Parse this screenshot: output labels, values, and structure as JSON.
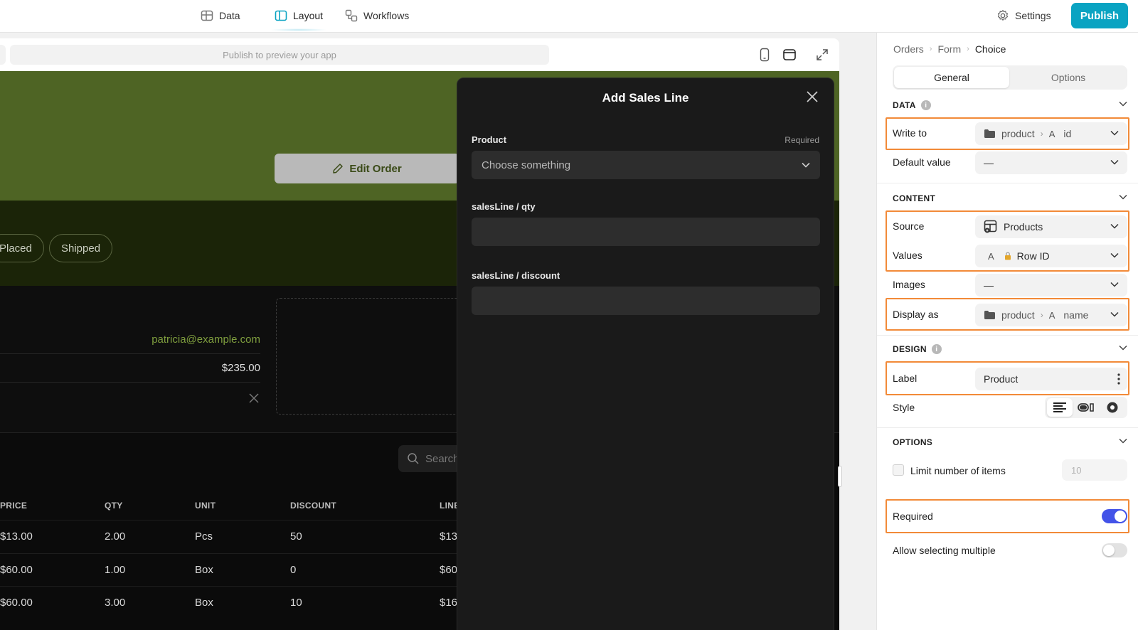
{
  "topbar": {
    "tabs": [
      {
        "label": "Data",
        "icon": "table-icon"
      },
      {
        "label": "Layout",
        "icon": "layout-icon"
      },
      {
        "label": "Workflows",
        "icon": "workflow-icon"
      }
    ],
    "settings_label": "Settings",
    "publish_label": "Publish"
  },
  "preview": {
    "url_placeholder": "Publish to preview your app"
  },
  "app": {
    "edit_order_label": "Edit Order",
    "status_pills": [
      "Placed",
      "Shipped"
    ],
    "info": {
      "email": "patricia@example.com",
      "amount": "$235.00"
    },
    "search_placeholder": "Search",
    "table": {
      "columns": [
        "PRICE",
        "QTY",
        "UNIT",
        "DISCOUNT",
        "LINE"
      ],
      "rows": [
        [
          "$13.00",
          "2.00",
          "Pcs",
          "50",
          "$13"
        ],
        [
          "$60.00",
          "1.00",
          "Box",
          "0",
          "$60"
        ],
        [
          "$60.00",
          "3.00",
          "Box",
          "10",
          "$16"
        ]
      ]
    }
  },
  "modal": {
    "title": "Add Sales Line",
    "fields": [
      {
        "label": "Product",
        "required_text": "Required",
        "placeholder": "Choose something"
      },
      {
        "label": "salesLine / qty",
        "value": ""
      },
      {
        "label": "salesLine / discount",
        "value": ""
      }
    ]
  },
  "panel": {
    "breadcrumb": [
      "Orders",
      "Form",
      "Choice"
    ],
    "tabs": {
      "general": "General",
      "options": "Options"
    },
    "sections": {
      "data": "DATA",
      "content": "CONTENT",
      "design": "DESIGN",
      "options": "OPTIONS"
    },
    "props": {
      "write_to": {
        "label": "Write to",
        "path": "product",
        "glyph": "A",
        "field": "id"
      },
      "default_value": {
        "label": "Default value",
        "value": "—"
      },
      "source": {
        "label": "Source",
        "value": "Products"
      },
      "values": {
        "label": "Values",
        "glyph": "A",
        "value": "Row ID"
      },
      "images": {
        "label": "Images",
        "value": "—"
      },
      "display_as": {
        "label": "Display as",
        "path": "product",
        "glyph": "A",
        "field": "name"
      },
      "label": {
        "label": "Label",
        "value": "Product"
      },
      "style": {
        "label": "Style"
      },
      "limit": {
        "label": "Limit number of items",
        "placeholder": "10"
      },
      "required": {
        "label": "Required",
        "on": true
      },
      "allow_multiple": {
        "label": "Allow selecting multiple",
        "on": false
      }
    },
    "colors": {
      "highlight": "#f28a38",
      "toggle_on": "#4353e8",
      "publish": "#0aa3c2"
    }
  }
}
